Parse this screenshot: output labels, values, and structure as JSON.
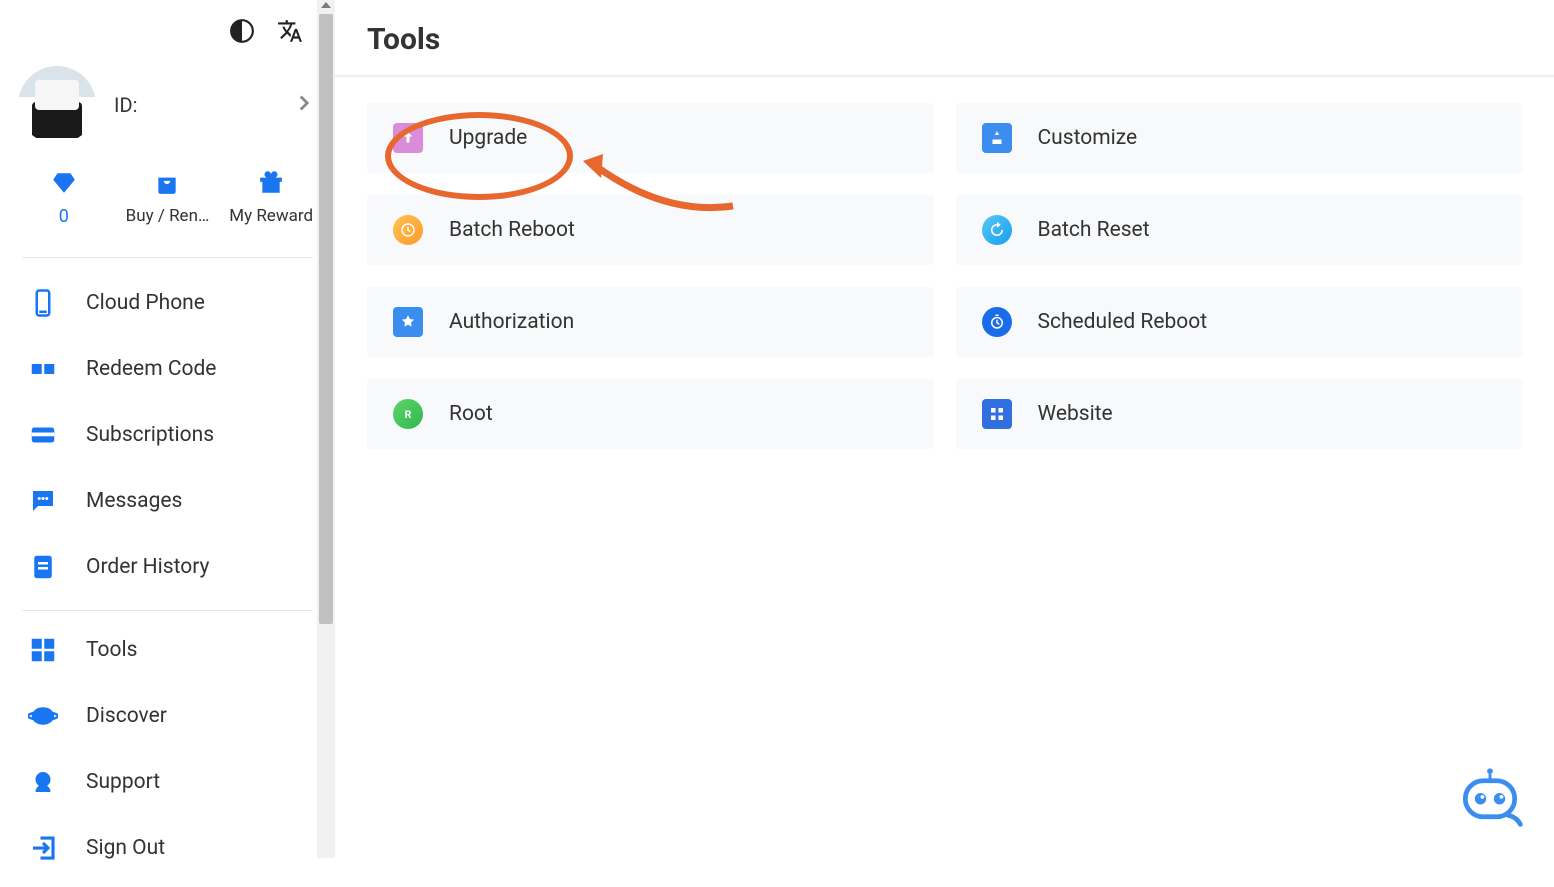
{
  "header": {
    "title": "Tools"
  },
  "profile": {
    "id_label": "ID: ",
    "gem_value": "0",
    "buy_label": "Buy / Ren…",
    "reward_label": "My Reward"
  },
  "sidebar": {
    "items": [
      {
        "label": "Cloud Phone"
      },
      {
        "label": "Redeem Code"
      },
      {
        "label": "Subscriptions"
      },
      {
        "label": "Messages"
      },
      {
        "label": "Order History"
      },
      {
        "label": "Tools"
      },
      {
        "label": "Discover"
      },
      {
        "label": "Support"
      },
      {
        "label": "Sign Out"
      }
    ]
  },
  "tools": [
    {
      "label": "Upgrade",
      "icon": "upgrade"
    },
    {
      "label": "Customize",
      "icon": "customize"
    },
    {
      "label": "Batch Reboot",
      "icon": "batch-reboot"
    },
    {
      "label": "Batch Reset",
      "icon": "batch-reset"
    },
    {
      "label": "Authorization",
      "icon": "authorization"
    },
    {
      "label": "Scheduled Reboot",
      "icon": "scheduled-reboot"
    },
    {
      "label": "Root",
      "icon": "root"
    },
    {
      "label": "Website",
      "icon": "website"
    }
  ]
}
